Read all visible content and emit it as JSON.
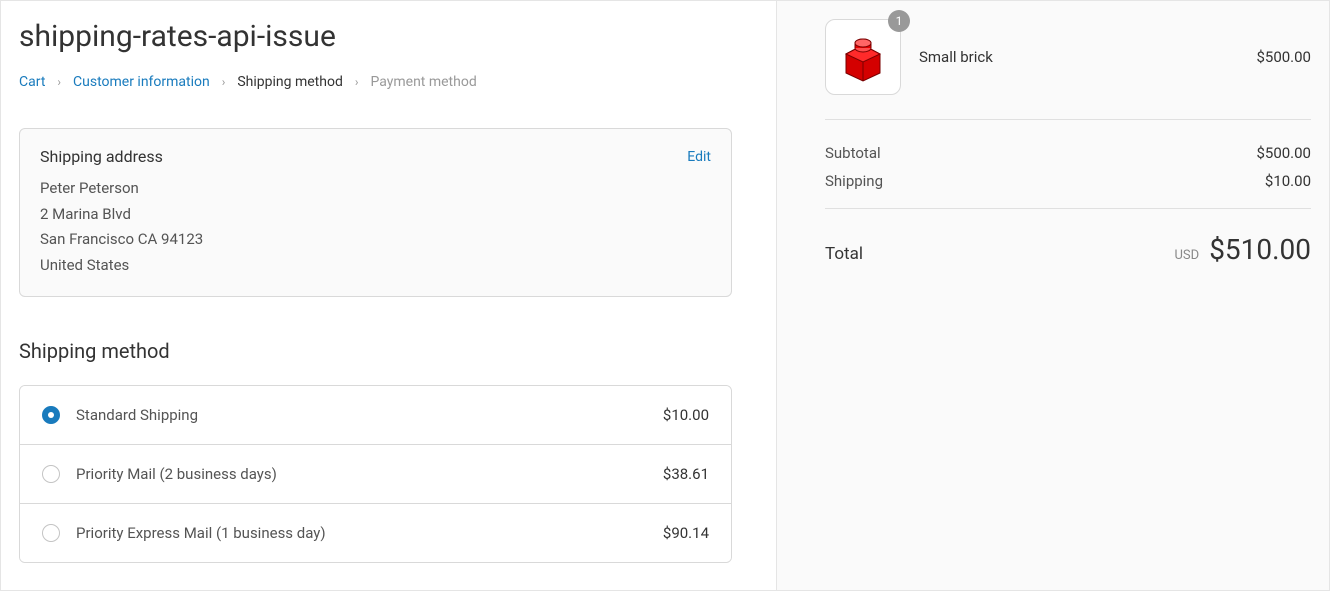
{
  "title": "shipping-rates-api-issue",
  "breadcrumb": {
    "cart": "Cart",
    "customer": "Customer information",
    "shipping": "Shipping method",
    "payment": "Payment method"
  },
  "shipping_address": {
    "label": "Shipping address",
    "edit": "Edit",
    "name": "Peter Peterson",
    "street": "2 Marina Blvd",
    "city_state_zip": "San Francisco CA 94123",
    "country": "United States"
  },
  "shipping_method": {
    "title": "Shipping method",
    "options": [
      {
        "label": "Standard Shipping",
        "price": "$10.00",
        "selected": true
      },
      {
        "label": "Priority Mail (2 business days)",
        "price": "$38.61",
        "selected": false
      },
      {
        "label": "Priority Express Mail (1 business day)",
        "price": "$90.14",
        "selected": false
      }
    ]
  },
  "cart": {
    "item": {
      "name": "Small brick",
      "qty": "1",
      "price": "$500.00"
    },
    "subtotal_label": "Subtotal",
    "subtotal": "$500.00",
    "shipping_label": "Shipping",
    "shipping": "$10.00",
    "total_label": "Total",
    "currency": "USD",
    "total": "$510.00"
  }
}
